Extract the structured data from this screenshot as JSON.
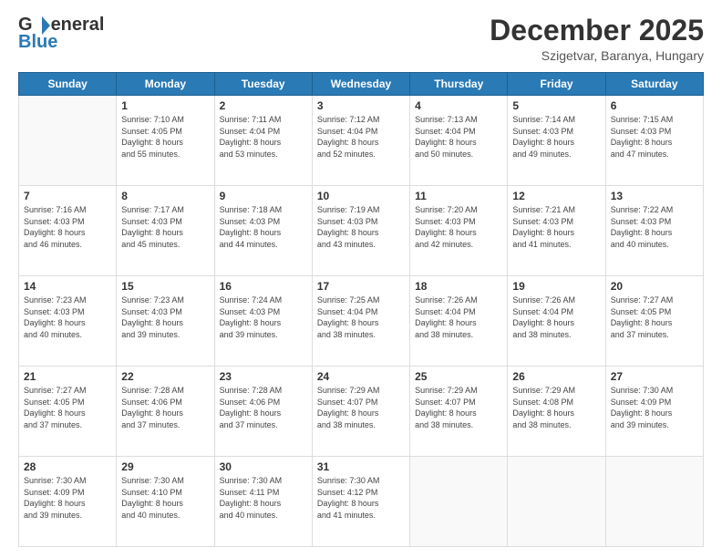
{
  "header": {
    "logo_general": "General",
    "logo_blue": "Blue",
    "month_title": "December 2025",
    "location": "Szigetvar, Baranya, Hungary"
  },
  "weekdays": [
    "Sunday",
    "Monday",
    "Tuesday",
    "Wednesday",
    "Thursday",
    "Friday",
    "Saturday"
  ],
  "weeks": [
    [
      {
        "day": "",
        "info": ""
      },
      {
        "day": "1",
        "info": "Sunrise: 7:10 AM\nSunset: 4:05 PM\nDaylight: 8 hours\nand 55 minutes."
      },
      {
        "day": "2",
        "info": "Sunrise: 7:11 AM\nSunset: 4:04 PM\nDaylight: 8 hours\nand 53 minutes."
      },
      {
        "day": "3",
        "info": "Sunrise: 7:12 AM\nSunset: 4:04 PM\nDaylight: 8 hours\nand 52 minutes."
      },
      {
        "day": "4",
        "info": "Sunrise: 7:13 AM\nSunset: 4:04 PM\nDaylight: 8 hours\nand 50 minutes."
      },
      {
        "day": "5",
        "info": "Sunrise: 7:14 AM\nSunset: 4:03 PM\nDaylight: 8 hours\nand 49 minutes."
      },
      {
        "day": "6",
        "info": "Sunrise: 7:15 AM\nSunset: 4:03 PM\nDaylight: 8 hours\nand 47 minutes."
      }
    ],
    [
      {
        "day": "7",
        "info": "Sunrise: 7:16 AM\nSunset: 4:03 PM\nDaylight: 8 hours\nand 46 minutes."
      },
      {
        "day": "8",
        "info": "Sunrise: 7:17 AM\nSunset: 4:03 PM\nDaylight: 8 hours\nand 45 minutes."
      },
      {
        "day": "9",
        "info": "Sunrise: 7:18 AM\nSunset: 4:03 PM\nDaylight: 8 hours\nand 44 minutes."
      },
      {
        "day": "10",
        "info": "Sunrise: 7:19 AM\nSunset: 4:03 PM\nDaylight: 8 hours\nand 43 minutes."
      },
      {
        "day": "11",
        "info": "Sunrise: 7:20 AM\nSunset: 4:03 PM\nDaylight: 8 hours\nand 42 minutes."
      },
      {
        "day": "12",
        "info": "Sunrise: 7:21 AM\nSunset: 4:03 PM\nDaylight: 8 hours\nand 41 minutes."
      },
      {
        "day": "13",
        "info": "Sunrise: 7:22 AM\nSunset: 4:03 PM\nDaylight: 8 hours\nand 40 minutes."
      }
    ],
    [
      {
        "day": "14",
        "info": "Sunrise: 7:23 AM\nSunset: 4:03 PM\nDaylight: 8 hours\nand 40 minutes."
      },
      {
        "day": "15",
        "info": "Sunrise: 7:23 AM\nSunset: 4:03 PM\nDaylight: 8 hours\nand 39 minutes."
      },
      {
        "day": "16",
        "info": "Sunrise: 7:24 AM\nSunset: 4:03 PM\nDaylight: 8 hours\nand 39 minutes."
      },
      {
        "day": "17",
        "info": "Sunrise: 7:25 AM\nSunset: 4:04 PM\nDaylight: 8 hours\nand 38 minutes."
      },
      {
        "day": "18",
        "info": "Sunrise: 7:26 AM\nSunset: 4:04 PM\nDaylight: 8 hours\nand 38 minutes."
      },
      {
        "day": "19",
        "info": "Sunrise: 7:26 AM\nSunset: 4:04 PM\nDaylight: 8 hours\nand 38 minutes."
      },
      {
        "day": "20",
        "info": "Sunrise: 7:27 AM\nSunset: 4:05 PM\nDaylight: 8 hours\nand 37 minutes."
      }
    ],
    [
      {
        "day": "21",
        "info": "Sunrise: 7:27 AM\nSunset: 4:05 PM\nDaylight: 8 hours\nand 37 minutes."
      },
      {
        "day": "22",
        "info": "Sunrise: 7:28 AM\nSunset: 4:06 PM\nDaylight: 8 hours\nand 37 minutes."
      },
      {
        "day": "23",
        "info": "Sunrise: 7:28 AM\nSunset: 4:06 PM\nDaylight: 8 hours\nand 37 minutes."
      },
      {
        "day": "24",
        "info": "Sunrise: 7:29 AM\nSunset: 4:07 PM\nDaylight: 8 hours\nand 38 minutes."
      },
      {
        "day": "25",
        "info": "Sunrise: 7:29 AM\nSunset: 4:07 PM\nDaylight: 8 hours\nand 38 minutes."
      },
      {
        "day": "26",
        "info": "Sunrise: 7:29 AM\nSunset: 4:08 PM\nDaylight: 8 hours\nand 38 minutes."
      },
      {
        "day": "27",
        "info": "Sunrise: 7:30 AM\nSunset: 4:09 PM\nDaylight: 8 hours\nand 39 minutes."
      }
    ],
    [
      {
        "day": "28",
        "info": "Sunrise: 7:30 AM\nSunset: 4:09 PM\nDaylight: 8 hours\nand 39 minutes."
      },
      {
        "day": "29",
        "info": "Sunrise: 7:30 AM\nSunset: 4:10 PM\nDaylight: 8 hours\nand 40 minutes."
      },
      {
        "day": "30",
        "info": "Sunrise: 7:30 AM\nSunset: 4:11 PM\nDaylight: 8 hours\nand 40 minutes."
      },
      {
        "day": "31",
        "info": "Sunrise: 7:30 AM\nSunset: 4:12 PM\nDaylight: 8 hours\nand 41 minutes."
      },
      {
        "day": "",
        "info": ""
      },
      {
        "day": "",
        "info": ""
      },
      {
        "day": "",
        "info": ""
      }
    ]
  ]
}
